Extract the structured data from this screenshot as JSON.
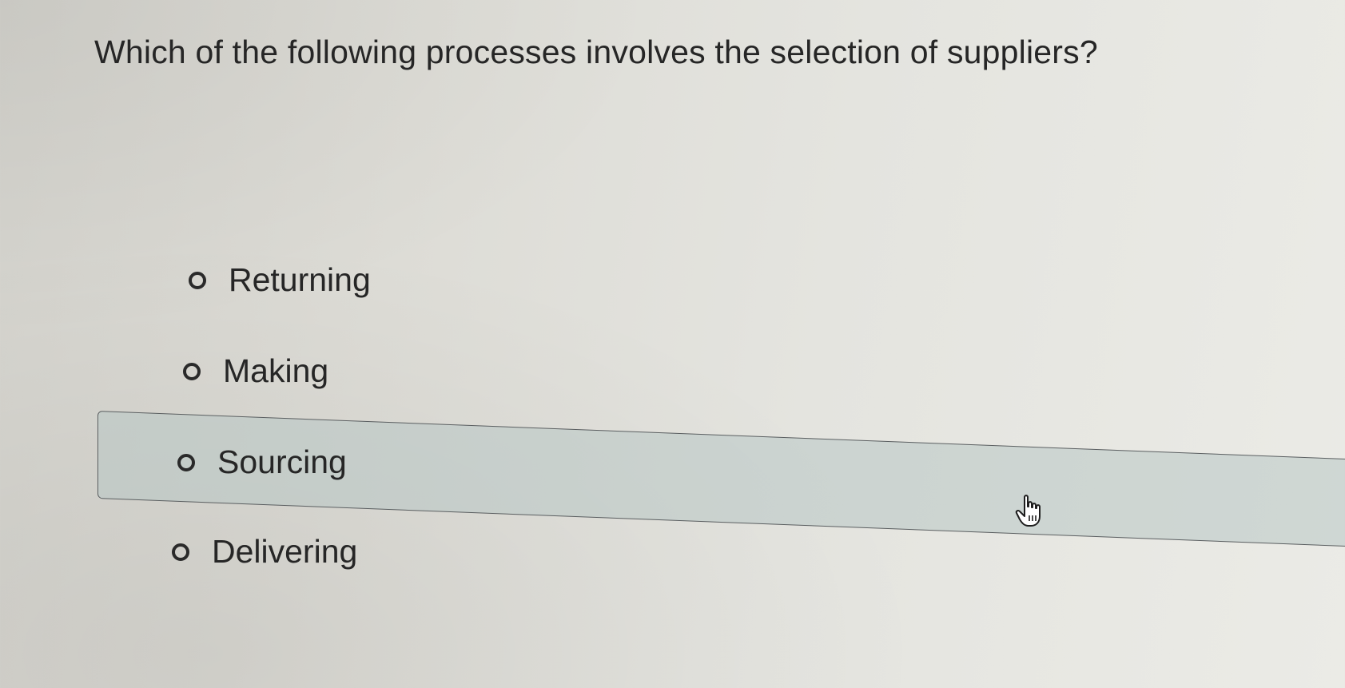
{
  "question": {
    "text": "Which of the following processes involves the selection of suppliers?"
  },
  "options": [
    {
      "label": "Returning",
      "selected": false,
      "hovered": false
    },
    {
      "label": "Making",
      "selected": false,
      "hovered": false
    },
    {
      "label": "Sourcing",
      "selected": false,
      "hovered": true
    },
    {
      "label": "Delivering",
      "selected": false,
      "hovered": false
    }
  ],
  "cursor": {
    "icon": "hand-pointer-icon"
  },
  "colors": {
    "hover_background": "#b8c6c4",
    "hover_border": "#5a5e60",
    "text": "#262626"
  }
}
